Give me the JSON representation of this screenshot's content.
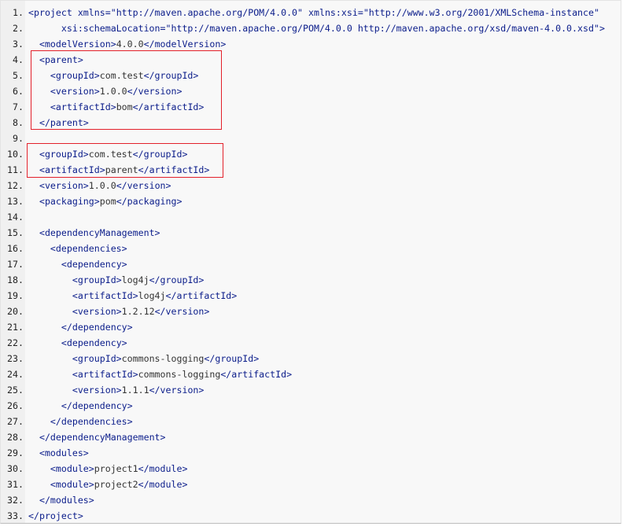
{
  "code_lines": [
    {
      "n": "1.",
      "indent": 0,
      "parts": [
        [
          "tag",
          "<project "
        ],
        [
          "attr",
          "xmlns"
        ],
        [
          "tag",
          "="
        ],
        [
          "val",
          "\"http://maven.apache.org/POM/4.0.0\""
        ],
        [
          "tag",
          " "
        ],
        [
          "attr",
          "xmlns:xsi"
        ],
        [
          "tag",
          "="
        ],
        [
          "val",
          "\"http://www.w3.org/2001/XMLSchema-instance\""
        ]
      ]
    },
    {
      "n": "2.",
      "indent": 0,
      "parts": [
        [
          "attr",
          "      xsi:schemaLocation"
        ],
        [
          "tag",
          "="
        ],
        [
          "val",
          "\"http://maven.apache.org/POM/4.0.0 http://maven.apache.org/xsd/maven-4.0.0.xsd\""
        ],
        [
          "tag",
          ">"
        ]
      ]
    },
    {
      "n": "3.",
      "indent": 2,
      "parts": [
        [
          "tag",
          "<modelVersion>"
        ],
        [
          "text",
          "4.0.0"
        ],
        [
          "tag",
          "</modelVersion>"
        ]
      ]
    },
    {
      "n": "4.",
      "indent": 2,
      "parts": [
        [
          "tag",
          "<parent>"
        ]
      ]
    },
    {
      "n": "5.",
      "indent": 4,
      "parts": [
        [
          "tag",
          "<groupId>"
        ],
        [
          "text",
          "com.test"
        ],
        [
          "tag",
          "</groupId>"
        ]
      ]
    },
    {
      "n": "6.",
      "indent": 4,
      "parts": [
        [
          "tag",
          "<version>"
        ],
        [
          "text",
          "1.0.0"
        ],
        [
          "tag",
          "</version>"
        ]
      ]
    },
    {
      "n": "7.",
      "indent": 4,
      "parts": [
        [
          "tag",
          "<artifactId>"
        ],
        [
          "text",
          "bom"
        ],
        [
          "tag",
          "</artifactId>"
        ]
      ]
    },
    {
      "n": "8.",
      "indent": 2,
      "parts": [
        [
          "tag",
          "</parent>"
        ]
      ]
    },
    {
      "n": "9.",
      "indent": 0,
      "parts": []
    },
    {
      "n": "10.",
      "indent": 2,
      "parts": [
        [
          "tag",
          "<groupId>"
        ],
        [
          "text",
          "com.test"
        ],
        [
          "tag",
          "</groupId>"
        ]
      ]
    },
    {
      "n": "11.",
      "indent": 2,
      "parts": [
        [
          "tag",
          "<artifactId>"
        ],
        [
          "text",
          "parent"
        ],
        [
          "tag",
          "</artifactId>"
        ]
      ]
    },
    {
      "n": "12.",
      "indent": 2,
      "parts": [
        [
          "tag",
          "<version>"
        ],
        [
          "text",
          "1.0.0"
        ],
        [
          "tag",
          "</version>"
        ]
      ]
    },
    {
      "n": "13.",
      "indent": 2,
      "parts": [
        [
          "tag",
          "<packaging>"
        ],
        [
          "text",
          "pom"
        ],
        [
          "tag",
          "</packaging>"
        ]
      ]
    },
    {
      "n": "14.",
      "indent": 0,
      "parts": []
    },
    {
      "n": "15.",
      "indent": 2,
      "parts": [
        [
          "tag",
          "<dependencyManagement>"
        ]
      ]
    },
    {
      "n": "16.",
      "indent": 4,
      "parts": [
        [
          "tag",
          "<dependencies>"
        ]
      ]
    },
    {
      "n": "17.",
      "indent": 6,
      "parts": [
        [
          "tag",
          "<dependency>"
        ]
      ]
    },
    {
      "n": "18.",
      "indent": 8,
      "parts": [
        [
          "tag",
          "<groupId>"
        ],
        [
          "text",
          "log4j"
        ],
        [
          "tag",
          "</groupId>"
        ]
      ]
    },
    {
      "n": "19.",
      "indent": 8,
      "parts": [
        [
          "tag",
          "<artifactId>"
        ],
        [
          "text",
          "log4j"
        ],
        [
          "tag",
          "</artifactId>"
        ]
      ]
    },
    {
      "n": "20.",
      "indent": 8,
      "parts": [
        [
          "tag",
          "<version>"
        ],
        [
          "text",
          "1.2.12"
        ],
        [
          "tag",
          "</version>"
        ]
      ]
    },
    {
      "n": "21.",
      "indent": 6,
      "parts": [
        [
          "tag",
          "</dependency>"
        ]
      ]
    },
    {
      "n": "22.",
      "indent": 6,
      "parts": [
        [
          "tag",
          "<dependency>"
        ]
      ]
    },
    {
      "n": "23.",
      "indent": 8,
      "parts": [
        [
          "tag",
          "<groupId>"
        ],
        [
          "text",
          "commons-logging"
        ],
        [
          "tag",
          "</groupId>"
        ]
      ]
    },
    {
      "n": "24.",
      "indent": 8,
      "parts": [
        [
          "tag",
          "<artifactId>"
        ],
        [
          "text",
          "commons-logging"
        ],
        [
          "tag",
          "</artifactId>"
        ]
      ]
    },
    {
      "n": "25.",
      "indent": 8,
      "parts": [
        [
          "tag",
          "<version>"
        ],
        [
          "text",
          "1.1.1"
        ],
        [
          "tag",
          "</version>"
        ]
      ]
    },
    {
      "n": "26.",
      "indent": 6,
      "parts": [
        [
          "tag",
          "</dependency>"
        ]
      ]
    },
    {
      "n": "27.",
      "indent": 4,
      "parts": [
        [
          "tag",
          "</dependencies>"
        ]
      ]
    },
    {
      "n": "28.",
      "indent": 2,
      "parts": [
        [
          "tag",
          "</dependencyManagement>"
        ]
      ]
    },
    {
      "n": "29.",
      "indent": 2,
      "parts": [
        [
          "tag",
          "<modules>"
        ]
      ]
    },
    {
      "n": "30.",
      "indent": 4,
      "parts": [
        [
          "tag",
          "<module>"
        ],
        [
          "text",
          "project1"
        ],
        [
          "tag",
          "</module>"
        ]
      ]
    },
    {
      "n": "31.",
      "indent": 4,
      "parts": [
        [
          "tag",
          "<module>"
        ],
        [
          "text",
          "project2"
        ],
        [
          "tag",
          "</module>"
        ]
      ]
    },
    {
      "n": "32.",
      "indent": 2,
      "parts": [
        [
          "tag",
          "</modules>"
        ]
      ]
    },
    {
      "n": "33.",
      "indent": 0,
      "parts": [
        [
          "tag",
          "</project>"
        ]
      ]
    }
  ],
  "colors": {
    "background": "#f8f8f8",
    "gutter": "#f0f0f0",
    "tag": "#0a1c8a",
    "text": "#333333",
    "highlight_border": "#e3202a"
  }
}
